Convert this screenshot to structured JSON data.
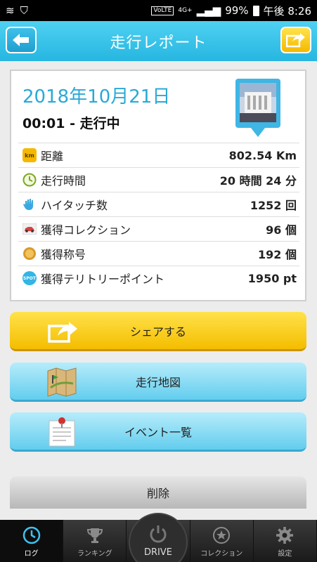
{
  "statusbar": {
    "battery": "99%",
    "time": "午後 8:26",
    "network": "4G+",
    "volte": "VoLTE"
  },
  "header": {
    "title": "走行レポート"
  },
  "report": {
    "date": "2018年10月21日",
    "status": "00:01 - 走行中",
    "rows": [
      {
        "icon": "km-icon",
        "label": "距離",
        "value": "802.54 Km"
      },
      {
        "icon": "clock-icon",
        "label": "走行時間",
        "value": "20 時間 24 分"
      },
      {
        "icon": "hand-icon",
        "label": "ハイタッチ数",
        "value": "1252 回"
      },
      {
        "icon": "car-icon",
        "label": "獲得コレクション",
        "value": "96 個"
      },
      {
        "icon": "medal-icon",
        "label": "獲得称号",
        "value": "192 個"
      },
      {
        "icon": "spot-icon",
        "label": "獲得テリトリーポイント",
        "value": "1950 pt"
      }
    ],
    "km_badge": "km",
    "spot_badge": "SPOT"
  },
  "buttons": {
    "share": "シェアする",
    "map": "走行地図",
    "events": "イベント一覧",
    "delete": "削除"
  },
  "nav": {
    "log": "ログ",
    "ranking": "ランキング",
    "drive": "DRIVE",
    "collection": "コレクション",
    "settings": "設定"
  },
  "colors": {
    "accent": "#26b6e0",
    "yellow": "#f5b900",
    "date": "#2aa9d6"
  }
}
